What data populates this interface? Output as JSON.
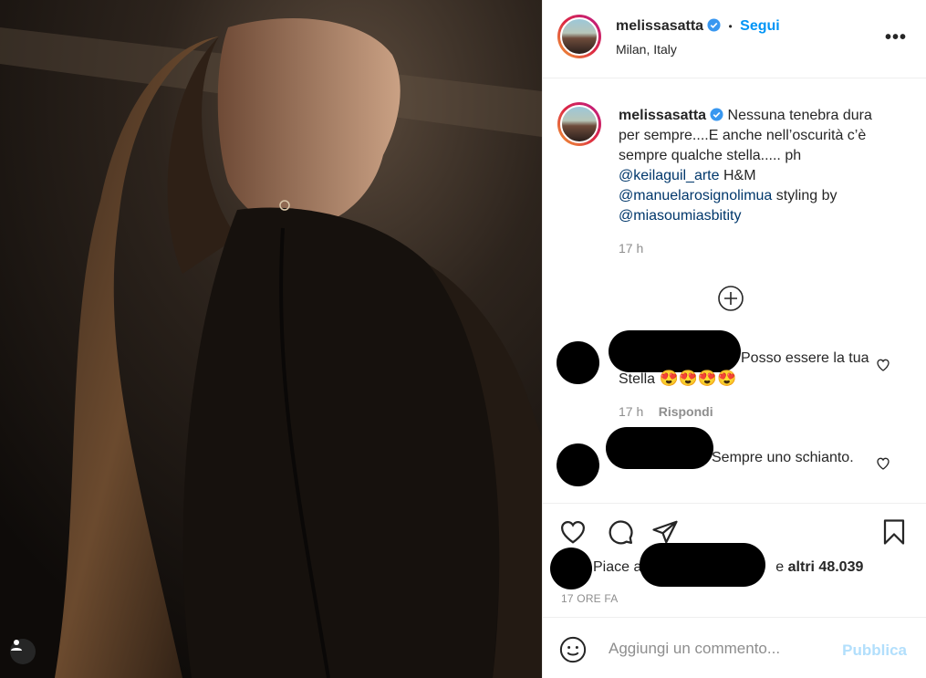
{
  "post": {
    "username": "melissasatta",
    "follow_label": "Segui",
    "separator": "•",
    "location": "Milan, Italy",
    "more_label": "•••"
  },
  "caption": {
    "username": "melissasatta",
    "text_1": "Nessuna tenebra dura per sempre....E anche nell’oscurità c’è sempre qualche stella..... ph",
    "mention_1": "@keilaguil_arte",
    "text_2": "H&M",
    "mention_2": "@manuelarosignolimua",
    "text_3": "styling by",
    "mention_3": "@miasoumiasbitity",
    "time": "17 h"
  },
  "comments": [
    {
      "text": "Posso essere la tua Stella",
      "emojis": "😍😍😍😍",
      "time": "17 h",
      "reply_label": "Rispondi"
    },
    {
      "text": "Sempre uno schianto."
    }
  ],
  "likes": {
    "prefix": "Piace a",
    "connector": "e",
    "others": "altri 48.039",
    "ago": "17 ore fa"
  },
  "composer": {
    "placeholder": "Aggiungi un commento...",
    "publish_label": "Pubblica"
  },
  "colors": {
    "accent": "#0095f6",
    "mention": "#00376b",
    "muted": "#8e8e8e",
    "publish_disabled": "#b2dffc"
  }
}
